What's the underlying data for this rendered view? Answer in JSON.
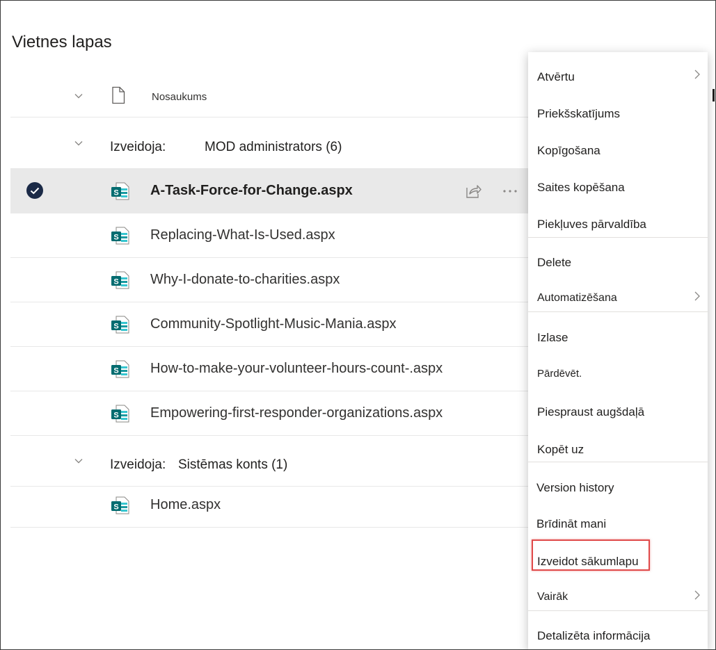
{
  "page": {
    "title": "Vietnes lapas"
  },
  "list": {
    "column_name": "Nosaukums",
    "groups": [
      {
        "label": "Izveidoja:",
        "value": "MOD administrators (6)"
      },
      {
        "label": "Izveidoja:",
        "value": "Sistēmas konts (1)"
      }
    ],
    "files": [
      {
        "name": "A-Task-Force-for-Change.aspx",
        "selected": true
      },
      {
        "name": "Replacing-What-Is-Used.aspx",
        "selected": false
      },
      {
        "name": "Why-I-donate-to-charities.aspx",
        "selected": false
      },
      {
        "name": "Community-Spotlight-Music-Mania.aspx",
        "selected": false
      },
      {
        "name": "How-to-make-your-volunteer-hours-count-.aspx",
        "selected": false
      },
      {
        "name": "Empowering-first-responder-organizations.aspx",
        "selected": false
      },
      {
        "name": "Home.aspx",
        "selected": false
      }
    ]
  },
  "context_menu": {
    "items": [
      {
        "label": "Atvērtu",
        "submenu": true
      },
      {
        "label": "Priekšskatījums",
        "submenu": false
      },
      {
        "label": "Kopīgošana",
        "submenu": false
      },
      {
        "label": "Saites kopēšana",
        "submenu": false
      },
      {
        "label": "Piekļuves pārvaldība",
        "submenu": false
      },
      {
        "label": "Delete",
        "submenu": false
      },
      {
        "label": "Automatizēšana",
        "submenu": true
      },
      {
        "label": "Izlase",
        "submenu": false
      },
      {
        "label": "Pārdēvēt.",
        "submenu": false
      },
      {
        "label": "Piespraust augšdaļā",
        "submenu": false
      },
      {
        "label": "Kopēt uz",
        "submenu": false
      },
      {
        "label": "Version history",
        "submenu": false
      },
      {
        "label": "Brīdināt mani",
        "submenu": false
      },
      {
        "label": "Izveidot sākumlapu",
        "submenu": false,
        "highlighted": true
      },
      {
        "label": "Vairāk",
        "submenu": true
      },
      {
        "label": "Detalizēta informācija",
        "submenu": false
      }
    ]
  },
  "colors": {
    "sharepoint_green": "#036c70",
    "sharepoint_teal": "#37c6d0",
    "selected_row": "#e9e9e9",
    "checkmark_bg": "#1b2a47",
    "highlight_border": "#e04a4a"
  },
  "icons": [
    "chevron-down-icon",
    "document-icon",
    "sharepoint-page-icon",
    "checkmark-circle-icon",
    "share-icon",
    "more-icon",
    "chevron-right-icon"
  ]
}
